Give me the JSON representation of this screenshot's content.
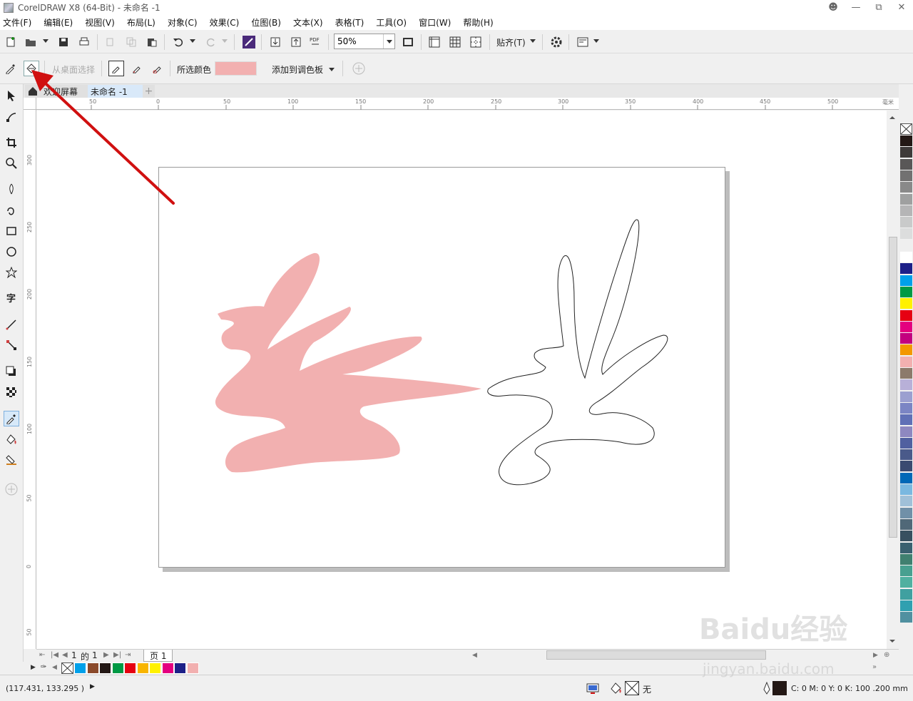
{
  "window": {
    "title": "CorelDRAW X8 (64-Bit) - 未命名 -1"
  },
  "menu": [
    "文件(F)",
    "编辑(E)",
    "视图(V)",
    "布局(L)",
    "对象(C)",
    "效果(C)",
    "位图(B)",
    "文本(X)",
    "表格(T)",
    "工具(O)",
    "窗口(W)",
    "帮助(H)"
  ],
  "toolbar": {
    "zoom_value": "50%",
    "snap_label": "贴齐(T)"
  },
  "propbar": {
    "from_desktop": "从桌面选择",
    "selected_color_label": "所选颜色",
    "selected_color": "#f2b0b0",
    "add_to_palette": "添加到调色板"
  },
  "tabs": {
    "welcome": "欢迎屏幕",
    "doc": "未命名 -1"
  },
  "ruler": {
    "units": "毫米",
    "top": [
      "50",
      "0",
      "50",
      "100",
      "150",
      "200",
      "250",
      "300",
      "350",
      "400",
      "450",
      "500"
    ],
    "left": [
      "300",
      "250",
      "200",
      "150",
      "100",
      "50",
      "0",
      "50"
    ]
  },
  "pagenav": {
    "current": "1",
    "of": "的",
    "total": "1",
    "page_tab": "页 1"
  },
  "status": {
    "coords": "(117.431, 133.295 )",
    "fill_none": "无",
    "outline_info": "C: 0 M: 0 Y: 0 K: 100  .200 mm"
  },
  "watermark": {
    "main": "Baidu经验",
    "sub": "jingyan.baidu.com"
  },
  "colors": {
    "accent_red": "#d01010",
    "shape_fill": "#f2b0b0",
    "palette": [
      "#231815",
      "#3e3a39",
      "#595757",
      "#727171",
      "#898989",
      "#9fa0a0",
      "#b5b5b6",
      "#c9caca",
      "#dcdddd",
      "#efefef",
      "#ffffff",
      "#1d2088",
      "#00a0e9",
      "#009944",
      "#fff100",
      "#e60012",
      "#e4007f",
      "#c3007f",
      "#f39800",
      "#f2b0b0",
      "#8c7a6b",
      "#b8b0d8",
      "#9b9fd0",
      "#7b85c4",
      "#6070b6",
      "#8e88c0",
      "#5060a0",
      "#4a5a8a",
      "#3a4a70",
      "#0068b7",
      "#7ab8e0",
      "#a0c0d8",
      "#7090a8",
      "#506878",
      "#385060",
      "#3a6070",
      "#408070",
      "#48a090",
      "#50b0a0",
      "#40a0a0",
      "#30a0b0",
      "#5090a0"
    ],
    "docpal": [
      "#00a0e9",
      "#8b4a2b",
      "#231815",
      "#009944",
      "#e60012",
      "#f8b500",
      "#fff100",
      "#e4007f",
      "#1d2088",
      "#f2b0b0"
    ]
  }
}
